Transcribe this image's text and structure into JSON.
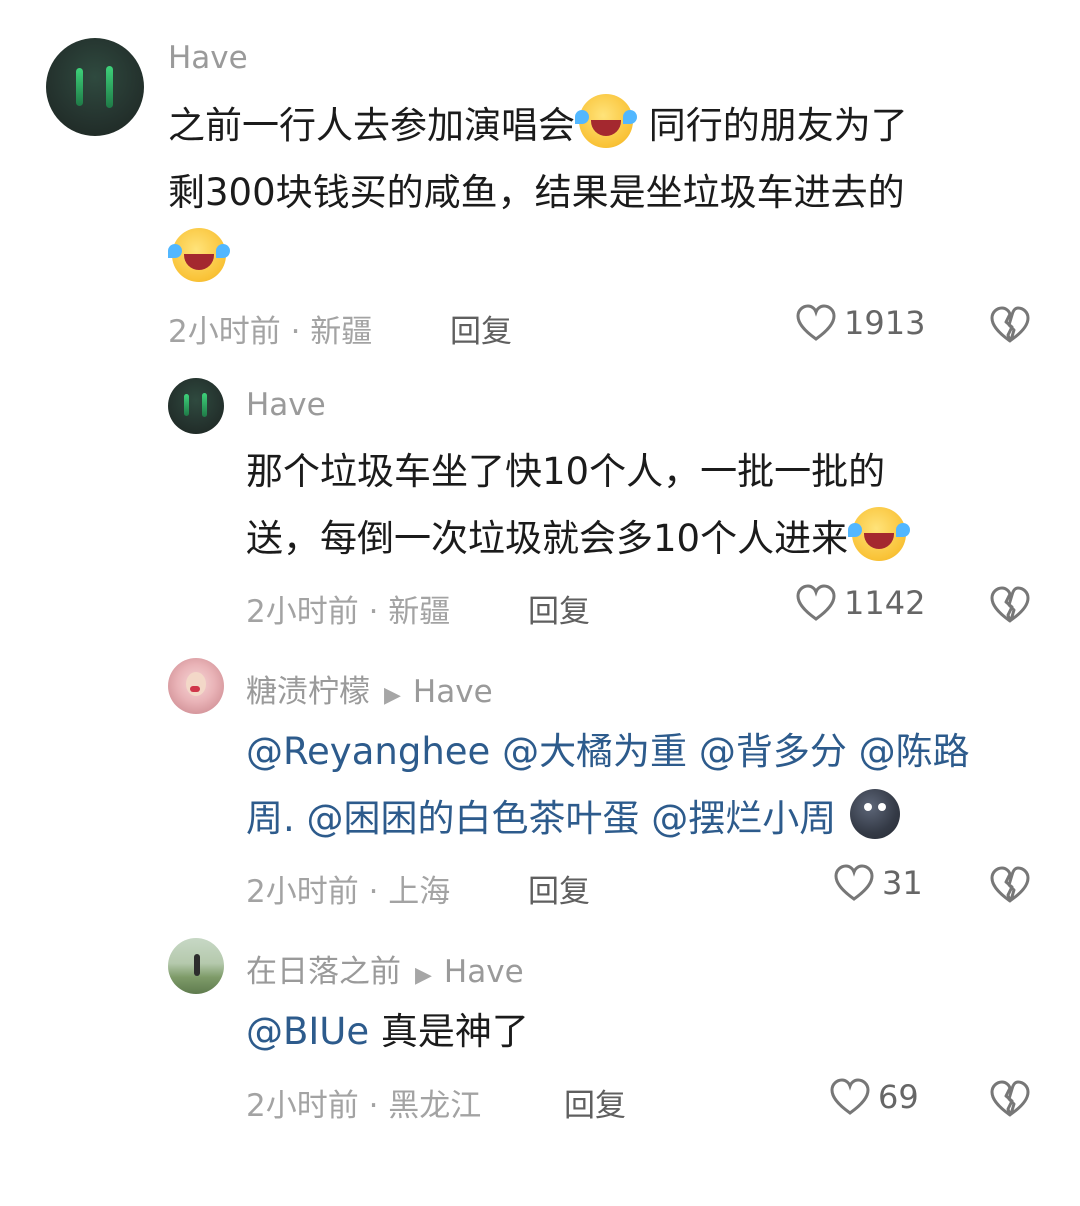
{
  "comments": [
    {
      "username": "Have",
      "reply_to": null,
      "text_lines": [
        [
          "之前一行人去参加演唱会",
          "[laugh]",
          " 同行的朋友为了"
        ],
        [
          "剩300块钱买的咸鱼，结果是坐垃圾车进去的"
        ],
        [
          "[laugh]"
        ]
      ],
      "line1_a": "之前一行人去参加演唱会",
      "line1_b": " 同行的朋友为了",
      "line2": "剩300块钱买的咸鱼，结果是坐垃圾车进去的",
      "meta": "2小时前 · 新疆",
      "reply_label": "回复",
      "likes": "1913"
    },
    {
      "username": "Have",
      "reply_to": null,
      "line1": "那个垃圾车坐了快10个人，一批一批的",
      "line2": "送，每倒一次垃圾就会多10个人进来",
      "meta": "2小时前 · 新疆",
      "reply_label": "回复",
      "likes": "1142"
    },
    {
      "username": "糖渍柠檬",
      "reply_to": "Have",
      "line1_parts": [
        "@Reyanghee",
        " ",
        "@大橘为重",
        " ",
        "@背多分",
        " ",
        "@陈路"
      ],
      "line2_parts": [
        "周.",
        " ",
        "@困困的白色茶叶蛋",
        " ",
        "@摆烂小周"
      ],
      "m1": "@Reyanghee",
      "m2": "@大橘为重",
      "m3": "@背多分",
      "m4": "@陈路",
      "m5": "周.",
      "m6": "@困困的白色茶叶蛋",
      "m7": "@摆烂小周",
      "meta": "2小时前 · 上海",
      "reply_label": "回复",
      "likes": "31"
    },
    {
      "username": "在日落之前",
      "reply_to": "Have",
      "mention": "@BIUe",
      "text": " 真是神了",
      "meta": "2小时前 · 黑龙江",
      "reply_label": "回复",
      "likes": "69"
    }
  ],
  "icons": {
    "like": "heart-outline-icon",
    "dislike": "broken-heart-icon",
    "emoji_laugh": "laughing-crying-emoji",
    "emoji_dark": "dark-face-emoji"
  },
  "colors": {
    "mention": "#2d5b8c",
    "meta": "#a3a3a3"
  }
}
